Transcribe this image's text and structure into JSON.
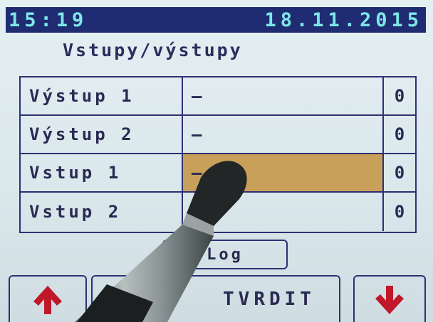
{
  "status_bar": {
    "time": "15:19",
    "date": "18.11.2015"
  },
  "title": "Vstupy/výstupy",
  "rows": [
    {
      "name": "Výstup 1",
      "state": "—",
      "value": "0",
      "selected": false
    },
    {
      "name": "Výstup 2",
      "state": "—",
      "value": "0",
      "selected": false
    },
    {
      "name": "Vstup 1",
      "state": "—",
      "value": "0",
      "selected": true
    },
    {
      "name": "Vstup 2",
      "state": "",
      "value": "0",
      "selected": false
    }
  ],
  "buttons": {
    "log_label": "Log",
    "confirm_label": "TVRDIT",
    "up_icon": "arrow-up-icon",
    "down_icon": "arrow-down-icon"
  },
  "colors": {
    "status_bar_bg": "#1f2c72",
    "status_bar_text": "#7fe7e8",
    "selected_cell": "#c8a05a",
    "arrow_red": "#c0182a"
  }
}
